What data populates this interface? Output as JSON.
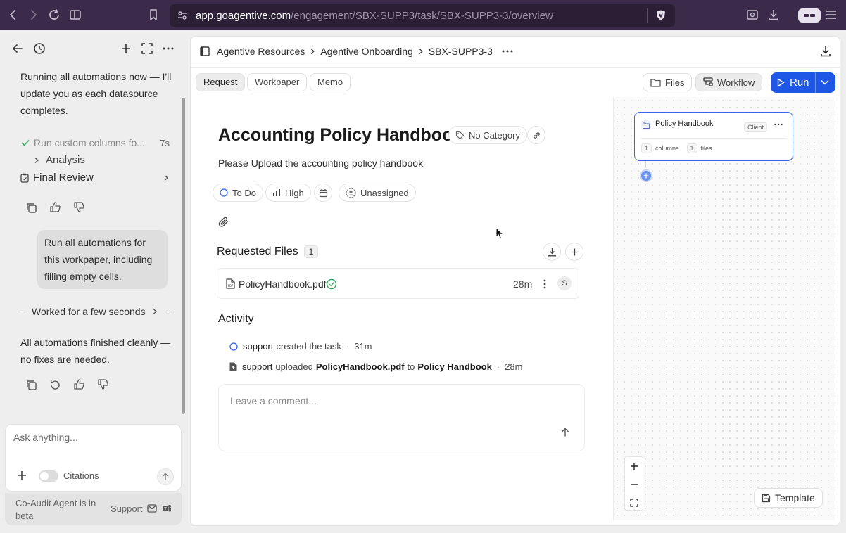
{
  "browser": {
    "url_host": "app.goagentive.com",
    "url_path": "/engagement/SBX-SUPP3/task/SBX-SUPP3-3/overview"
  },
  "chat": {
    "msg_running": "Running all automations now — I'll update you as each datasource completes.",
    "step_done_label": "Run custom columns fo...",
    "step_done_time": "7s",
    "analysis_label": "Analysis",
    "final_review_label": "Final Review",
    "user_message": "Run all automations for this workpaper, including filling empty cells.",
    "worked_label": "Worked for a few seconds",
    "final_message": "All automations finished cleanly — no fixes are needed.",
    "input_placeholder": "Ask anything...",
    "citations_label": "Citations",
    "beta_note": "Co-Audit Agent is in beta",
    "support_label": "Support"
  },
  "header": {
    "breadcrumb": [
      "Agentive Resources",
      "Agentive Onboarding",
      "SBX-SUPP3-3"
    ]
  },
  "tabs": [
    {
      "label": "Request",
      "active": true
    },
    {
      "label": "Workpaper",
      "active": false
    },
    {
      "label": "Memo",
      "active": false
    }
  ],
  "toolbar": {
    "files_label": "Files",
    "workflow_label": "Workflow",
    "run_label": "Run",
    "accent": "#1e57e6"
  },
  "task": {
    "title": "Accounting Policy Handbook",
    "category": "No Category",
    "description": "Please Upload the accounting policy handbook",
    "status": "To Do",
    "priority": "High",
    "assignee": "Unassigned"
  },
  "requested_files": {
    "heading": "Requested Files",
    "count": "1",
    "files": [
      {
        "name": "PolicyHandbook.pdf",
        "age": "28m",
        "avatar": "S"
      }
    ]
  },
  "activity": {
    "heading": "Activity",
    "items": [
      {
        "user": "support",
        "action": "created the task",
        "time": "31m"
      },
      {
        "user": "support",
        "action": "uploaded",
        "file": "PolicyHandbook.pdf",
        "to": "to",
        "target": "Policy Handbook",
        "time": "28m"
      }
    ],
    "comment_placeholder": "Leave a comment..."
  },
  "workflow_node": {
    "title": "Policy Handbook",
    "tag": "Client",
    "columns_count": "1",
    "columns_label": "columns",
    "files_count": "1",
    "files_label": "files"
  },
  "canvas": {
    "template_label": "Template"
  }
}
